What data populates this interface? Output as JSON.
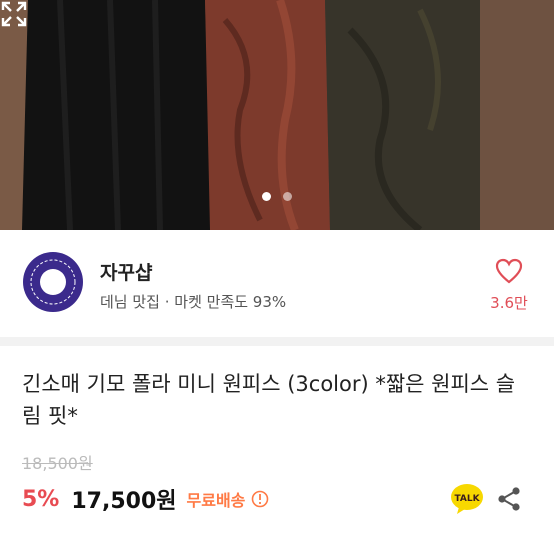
{
  "carousel": {
    "slides": 2,
    "active": 1
  },
  "shop": {
    "name": "자꾸샵",
    "meta": "데님 맛집 · 마켓 만족도 93%",
    "likes": "3.6만",
    "logo_text": "SHOP ZAGGU SHOP ZAGGU"
  },
  "product": {
    "title": "긴소매 기모 폴라 미니 원피스 (3color) *짧은 원피스 슬림 핏*",
    "original_price": "18,500원",
    "discount": "5%",
    "price": "17,500원",
    "shipping": "무료배송"
  },
  "icons": {
    "expand": "expand-icon",
    "heart": "heart-icon",
    "info": "info-icon",
    "talk": "kakao-talk-icon",
    "share": "share-icon"
  },
  "colors": {
    "accent": "#e84b52",
    "shipping": "#ff7a45",
    "logo": "#3b2a8c",
    "talk": "#f7d800"
  }
}
